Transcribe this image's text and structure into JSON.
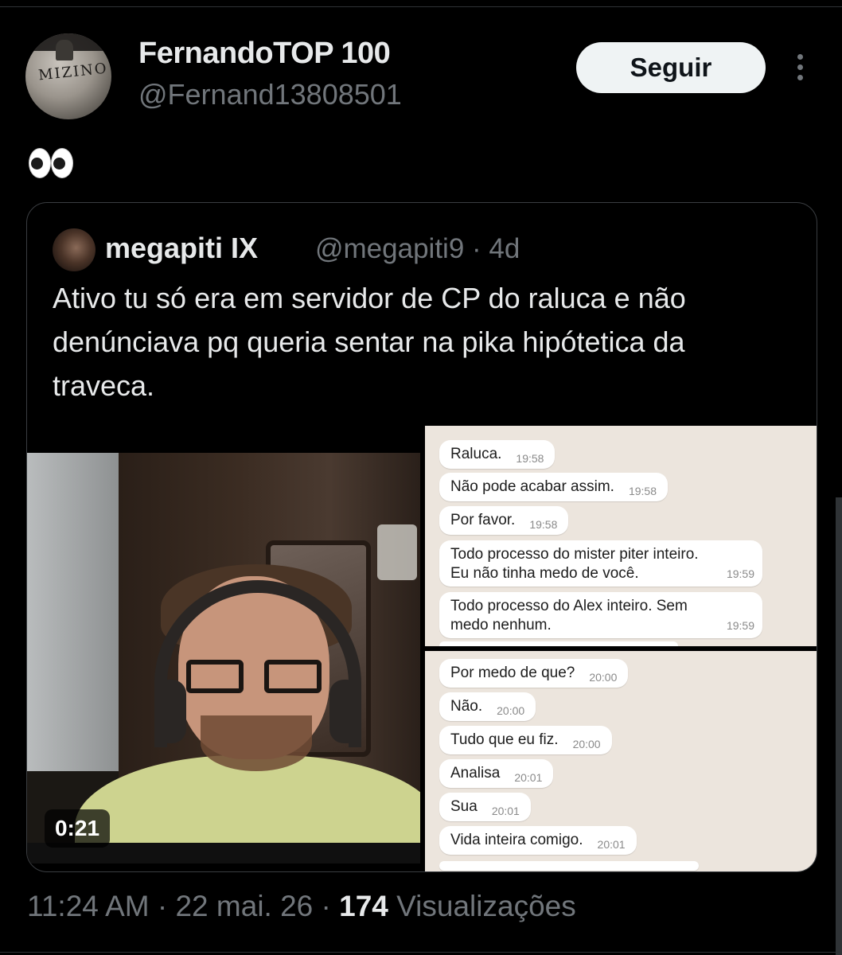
{
  "tweet": {
    "author_name": "FernandoTOP 100",
    "author_handle": "@Fernand13808501",
    "avatar_text": "MIZINO",
    "follow_label": "Seguir",
    "text": "👀",
    "time": "11:24 AM",
    "date": "22 mai. 26",
    "views_count": "174",
    "views_label": "Visualizações",
    "separator": "·"
  },
  "quoted": {
    "author_name": "megapiti IX",
    "author_handle": "@megapiti9 · 4d",
    "text": "Ativo tu só era em servidor de CP do raluca e não\ndenúnciava pq queria sentar na pika hipótetica da\ntraveca.",
    "video_duration": "0:21"
  },
  "chat_top": [
    {
      "text": "Raluca.",
      "time": "19:58"
    },
    {
      "text": "Não pode acabar assim.",
      "time": "19:58"
    },
    {
      "text": "Por favor.",
      "time": "19:58"
    },
    {
      "text": "Todo processo do mister piter inteiro. Eu não tinha medo de você.",
      "time": "19:59"
    },
    {
      "text": "Todo processo do Alex inteiro. Sem medo nenhum.",
      "time": "19:59"
    }
  ],
  "chat_bottom": [
    {
      "text": "Por medo de que?",
      "time": "20:00"
    },
    {
      "text": "Não.",
      "time": "20:00"
    },
    {
      "text": "Tudo que eu fiz.",
      "time": "20:00"
    },
    {
      "text": "Analisa",
      "time": "20:01"
    },
    {
      "text": "Sua",
      "time": "20:01"
    },
    {
      "text": "Vida inteira comigo.",
      "time": "20:01"
    }
  ],
  "colors": {
    "background": "#000000",
    "text_primary": "#e7e9ea",
    "text_secondary": "#71767b",
    "follow_button_bg": "#eff3f4",
    "chat_background": "#ece5dd"
  },
  "icons": [
    "more-options-icon",
    "eyes-emoji-icon"
  ]
}
